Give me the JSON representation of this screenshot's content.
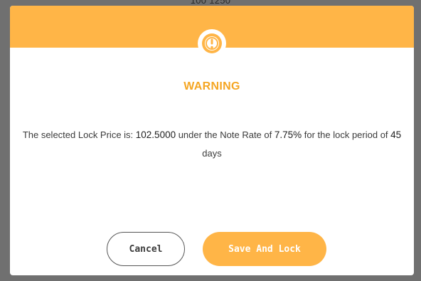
{
  "background": {
    "partial_text": "100 1250"
  },
  "dialog": {
    "icon": "exclamation-circle-icon",
    "title": "WARNING",
    "message": {
      "prefix": "The selected Lock Price is: ",
      "lock_price": "102.5000",
      "middle": " under the Note Rate of ",
      "note_rate": "7.75%",
      "suffix": " for the lock period of ",
      "period": "45",
      "unit": " days"
    },
    "buttons": {
      "cancel_label": "Cancel",
      "save_label": "Save And Lock"
    }
  },
  "colors": {
    "accent": "#ffb547",
    "title": "#f5a623",
    "backdrop": "#707070"
  }
}
